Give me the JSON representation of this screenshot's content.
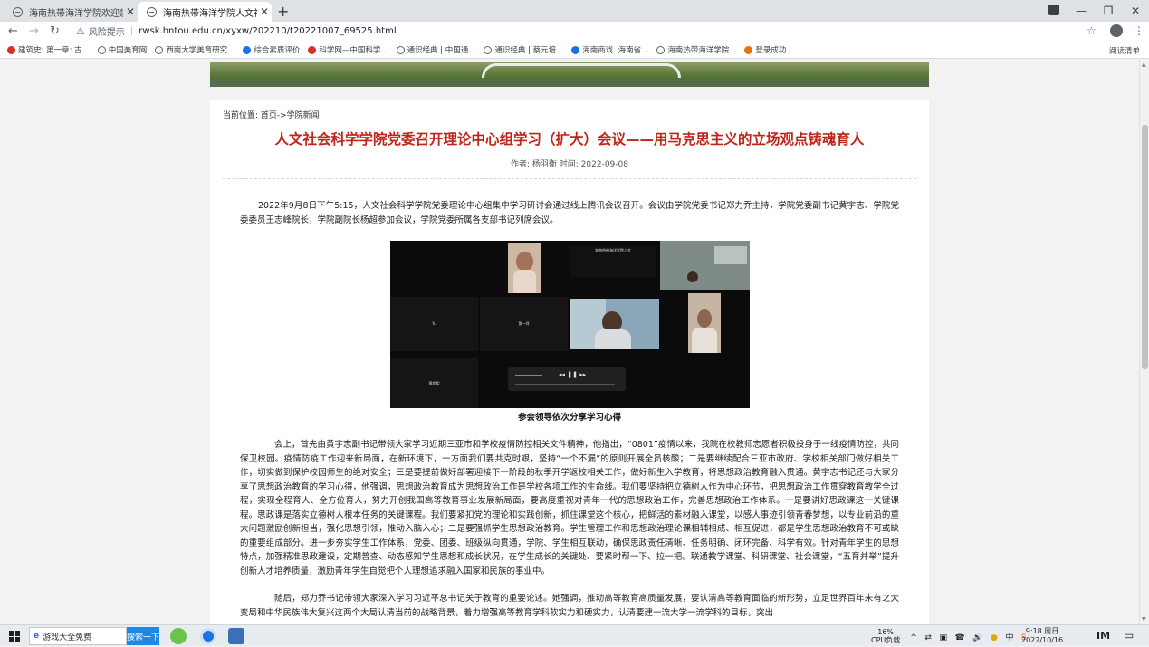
{
  "browser": {
    "tabs": [
      {
        "title": "海南热带海洋学院欢迎您",
        "active": false
      },
      {
        "title": "海南热带海洋学院人文社会科",
        "active": true
      }
    ],
    "new_tab": "+",
    "window_controls": {
      "minimize": "—",
      "restore": "❐",
      "close": "✕"
    },
    "omnibox": {
      "warning_label": "风险提示",
      "url": "rwsk.hntou.edu.cn/xyxw/202210/t20221007_69525.html"
    },
    "bookmarks": [
      "建筑史: 第一章: 古...",
      "中国美育网",
      "西南大学美育研究...",
      "综合素质评价",
      "科学网—中国科学...",
      "通识经典 | 中国通...",
      "通识经典 | 蔡元培...",
      "海南商戏. 海南省...",
      "海南热带海洋学院...",
      "登录成功"
    ],
    "reading_list": "阅读清单"
  },
  "article": {
    "breadcrumb": "当前位置: 首页->学院新闻",
    "title": "人文社会科学学院党委召开理论中心组学习（扩大）会议——用马克思主义的立场观点铸魂育人",
    "meta": "作者: 杨羽衡 时间: 2022-09-08",
    "paragraph1": "2022年9月8日下午5:15，人文社会科学学院党委理论中心组集中学习研讨会通过线上腾讯会议召开。会议由学院党委书记郑力乔主持，学院党委副书记黄宇志、学院党委委员王志峰院长，学院副院长杨超参加会议，学院党委所属各支部书记列席会议。",
    "image_caption": "参会领导依次分享学习心得",
    "paragraph2": "会上，首先由黄宇志副书记带领大家学习近期三亚市和学校疫情防控相关文件精神，他指出，“0801”疫情以来，我院在校教师志愿者积极投身于一线疫情防控，共同保卫校园。疫情防疫工作迎来新局面，在新环境下，一方面我们要共克时艰，坚持“一个不漏”的原则开展全员核酸；二是要继续配合三亚市政府、学校相关部门做好相关工作，切实做到保护校园师生的绝对安全；三是要提前做好部署迎接下一阶段的秋季开学返校相关工作，做好新生入学教育，将思想政治教育融入贯通。黄宇志书记还与大家分享了思想政治教育的学习心得，他强调，思想政治教育成为思想政治工作是学校各项工作的生命线。我们要坚持把立德树人作为中心环节，把思想政治工作贯穿教育教学全过程，实现全程育人、全方位育人，努力开创我国高等教育事业发展新局面，要高度重视对青年一代的思想政治工作，完善思想政治工作体系。一是要讲好思政课这一关键课程。思政课是落实立德树人根本任务的关键课程。我们要紧扣党的理论和实践创新，抓住课堂这个核心，把鲜活的素材融入课堂，以感人事迹引领青春梦想，以专业前沿的重大问题激励创新担当，强化思想引领，推动入脑入心；二是要强抓学生思想政治教育。学生管理工作和思想政治理论课相辅相成、相互促进，都是学生思想政治教育不可或缺的重要组成部分。进一步夯实学生工作体系，党委、团委、班级纵向贯通，学院、学生相互联动，确保思政责任清晰、任务明确、闭环完备、科学有效。针对青年学生的思想特点，加强精准思政建设，定期普查、动态感知学生思想和成长状况，在学生成长的关键处、要紧时帮一下、拉一把。联通教学课堂、科研课堂、社会课堂，“五育并举”提升创新人才培养质量，激励青年学生自觉把个人理想追求融入国家和民族的事业中。",
    "paragraph3": "随后，郑力乔书记带领大家深入学习习近平总书记关于教育的重要论述。她强调，推动高等教育高质量发展，要认清高等教育面临的新形势，立足世界百年未有之大变局和中华民族伟大复兴这两个大局认清当前的战略背景，着力增强高等教育学科软实力和硬实力，认清要建一流大学一流学科的目标，突出"
  },
  "video_labels": {
    "top_center": "海南热带海洋学院人文",
    "mid_left": "Yu",
    "mid_center": "第一师",
    "bottom_left": "黄超熙"
  },
  "taskbar": {
    "search_text": "游戏大全免费",
    "search_button": "搜索一下",
    "cpu_percent": "16%",
    "cpu_label": "CPU负载",
    "tray_icons": [
      "^",
      "⇄",
      "▣",
      "☎",
      "🔊",
      "●",
      "中",
      "S"
    ],
    "time": "9:18 周日",
    "date": "2022/10/16",
    "im_label": "IM"
  },
  "colors": {
    "title_red": "#c0251a",
    "search_button_blue": "#1e88e5"
  }
}
